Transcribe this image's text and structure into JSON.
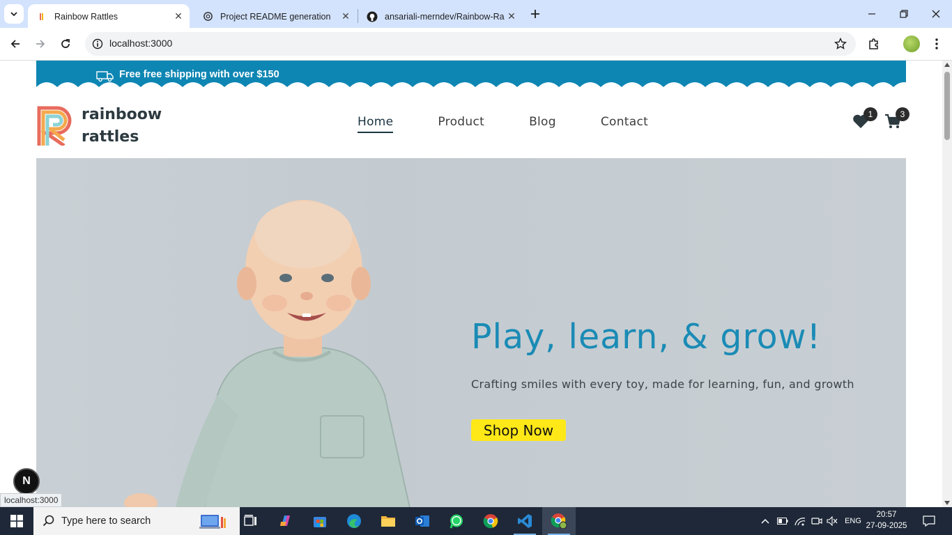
{
  "browser": {
    "tabs": [
      {
        "label": "Rainbow Rattles",
        "active": true
      },
      {
        "label": "Project README generation",
        "active": false
      },
      {
        "label": "ansariali-merndev/Rainbow-Ra",
        "active": false
      }
    ],
    "url": "localhost:3000"
  },
  "site": {
    "announcement": "Free  free shipping with over $150",
    "logo": {
      "line1": "rainboow",
      "line2": "rattles"
    },
    "nav": [
      "Home",
      "Product",
      "Blog",
      "Contact"
    ],
    "wishlist_count": "1",
    "cart_count": "3",
    "hero": {
      "title": "Play, learn, & grow!",
      "subtitle": "Crafting smiles with every toy, made for learning, fun, and growth",
      "cta": "Shop Now"
    }
  },
  "devtools": {
    "next_badge": "N",
    "status_url": "localhost:3000"
  },
  "taskbar": {
    "search_placeholder": "Type here to search",
    "language": "ENG",
    "time": "20:57",
    "date": "27-09-2025"
  },
  "colors": {
    "announcement_bg": "#0e86b3",
    "hero_title": "#1a8bb5",
    "cta_bg": "#ffe817",
    "tabstrip_bg": "#d3e3fd",
    "taskbar_bg": "#1e2838"
  }
}
